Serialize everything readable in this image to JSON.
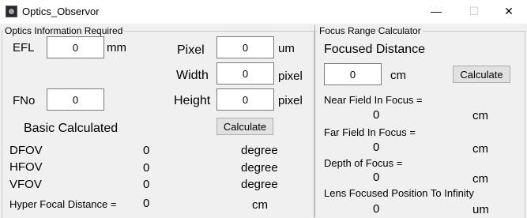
{
  "window": {
    "title": "Optics_Observor",
    "minimize_glyph": "—",
    "maximize_glyph": "☐",
    "close_glyph": "✕"
  },
  "optics": {
    "group_title": "Optics Information Required",
    "efl_label": "EFL",
    "efl_value": "0",
    "efl_unit": "mm",
    "fno_label": "FNo",
    "fno_value": "0",
    "pixel_label": "Pixel",
    "pixel_value": "0",
    "pixel_unit": "um",
    "width_label": "Width",
    "width_value": "0",
    "width_unit": "pixel",
    "height_label": "Height",
    "height_value": "0",
    "height_unit": "pixel",
    "calculate_label": "Calculate"
  },
  "basic": {
    "title": "Basic Calculated",
    "rows": [
      {
        "label": "DFOV",
        "value": "0",
        "unit": "degree"
      },
      {
        "label": "HFOV",
        "value": "0",
        "unit": "degree"
      },
      {
        "label": "VFOV",
        "value": "0",
        "unit": "degree"
      }
    ],
    "hyper_label": "Hyper Focal Distance =",
    "hyper_value": "0",
    "hyper_unit": "cm"
  },
  "focus": {
    "group_title": "Focus Range Calculator",
    "focused_distance_label": "Focused Distance",
    "focused_distance_value": "0",
    "focused_distance_unit": "cm",
    "calculate_label": "Calculate",
    "near_label": "Near Field In Focus =",
    "near_value": "0",
    "near_unit": "cm",
    "far_label": "Far Field In Focus =",
    "far_value": "0",
    "far_unit": "cm",
    "depth_label": "Depth of Focus =",
    "depth_value": "0",
    "depth_unit": "cm",
    "lens_label": "Lens Focused Position To Infinity",
    "lens_value": "0",
    "lens_unit": "um"
  }
}
